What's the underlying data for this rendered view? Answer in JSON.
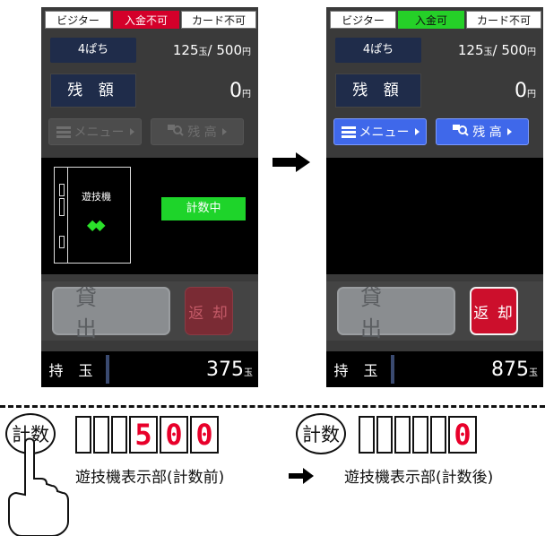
{
  "status_tags": {
    "visitor": "ビジター",
    "deposit_disabled": "入金不可",
    "deposit_enabled": "入金可",
    "card_disabled": "カード不可"
  },
  "rate": {
    "kind": "4ぱち",
    "balls": "125",
    "balls_unit": "玉",
    "separator": "/",
    "yen": "500",
    "yen_unit": "円"
  },
  "balance": {
    "label": "残 額",
    "value": "0",
    "unit": "円"
  },
  "menu": {
    "menu_label": "メニュー",
    "balance_label": "残 高"
  },
  "machine": {
    "label": "遊技機",
    "counting_label": "計数中"
  },
  "actions": {
    "lend_label": "貸 出",
    "return_label": "返 却"
  },
  "balls": {
    "label": "持 玉",
    "before_value": "375",
    "after_value": "875",
    "unit": "玉"
  },
  "bottom": {
    "count_label": "計数",
    "display_before_digits": [
      "",
      "",
      "",
      "5",
      "0",
      "0"
    ],
    "display_after_digits": [
      "",
      "",
      "",
      "",
      "",
      "0"
    ],
    "title_before": "遊技機表示部(計数前)",
    "title_after": "遊技機表示部(計数後)"
  },
  "colors": {
    "status_red": "#d4002a",
    "status_green": "#25d028",
    "menu_blue": "#3f68ea",
    "counting_green": "#1ed42a",
    "return_red": "#cc0f2c",
    "digit_red": "#e8002a"
  },
  "icons": {
    "menu": "hamburger-icon",
    "balance": "search-balance-icon",
    "arrow": "right-arrow-icon",
    "hand": "pointing-hand-icon"
  }
}
